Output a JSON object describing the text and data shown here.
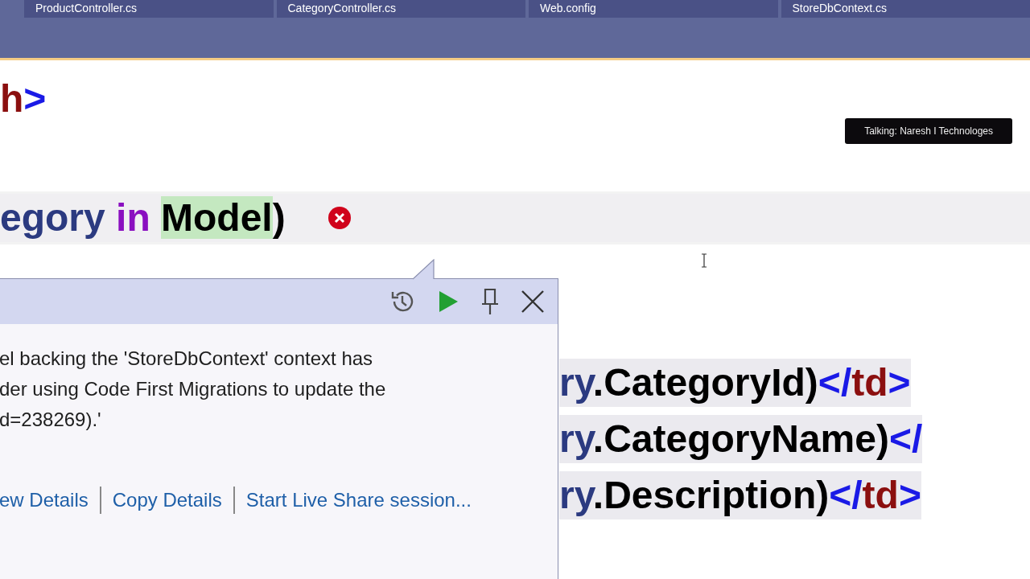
{
  "tabs": [
    {
      "label": "ProductController.cs",
      "selected": false
    },
    {
      "label": "CategoryController.cs",
      "selected": false
    },
    {
      "label": "Web.config",
      "selected": false
    },
    {
      "label": "StoreDbContext.cs",
      "selected": false
    }
  ],
  "talking": "Talking: Naresh I Technologes",
  "code_top": [
    {
      "tokens": [
        {
          "text": "h",
          "kind": "tag"
        },
        {
          "text": ">",
          "kind": "bracket"
        }
      ]
    },
    {
      "tokens": [
        {
          "text": "egory ",
          "kind": "ident"
        },
        {
          "text": "in ",
          "kind": "keyword"
        },
        {
          "text": "Model",
          "kind": "highlight"
        },
        {
          "text": ")",
          "kind": "plain"
        }
      ],
      "error": true
    }
  ],
  "code_right": [
    {
      "tokens": [
        {
          "text": "ry",
          "kind": "ident"
        },
        {
          "text": ".CategoryId)",
          "kind": "plain"
        },
        {
          "text": "</",
          "kind": "bracket"
        },
        {
          "text": "td",
          "kind": "tag"
        },
        {
          "text": ">",
          "kind": "bracket"
        }
      ]
    },
    {
      "tokens": [
        {
          "text": "ry",
          "kind": "ident"
        },
        {
          "text": ".CategoryName)",
          "kind": "plain"
        },
        {
          "text": "</",
          "kind": "bracket"
        }
      ]
    },
    {
      "tokens": [
        {
          "text": "ry",
          "kind": "ident"
        },
        {
          "text": ".Description)",
          "kind": "plain"
        },
        {
          "text": "</",
          "kind": "bracket"
        },
        {
          "text": "td",
          "kind": "tag"
        },
        {
          "text": ">",
          "kind": "bracket"
        }
      ]
    }
  ],
  "popup": {
    "message": [
      "el backing the 'StoreDbContext' context has",
      "der using Code First Migrations to update the",
      "d=238269).'"
    ],
    "links": [
      "ew Details",
      "Copy Details",
      "Start Live Share session..."
    ]
  }
}
